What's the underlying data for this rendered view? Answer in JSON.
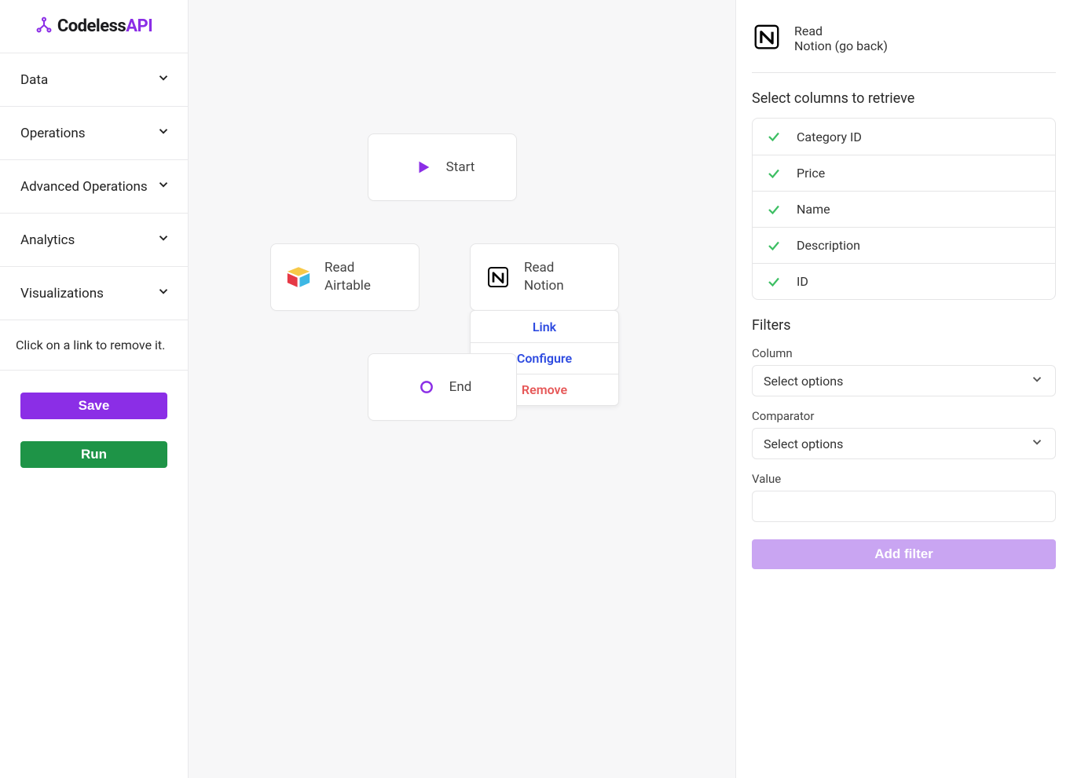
{
  "brand": {
    "pre": "Codeless",
    "post": "API"
  },
  "sidebar": {
    "items": [
      {
        "label": "Data"
      },
      {
        "label": "Operations"
      },
      {
        "label": "Advanced Operations"
      },
      {
        "label": "Analytics"
      },
      {
        "label": "Visualizations"
      }
    ],
    "hint": "Click on a link to remove it.",
    "save_label": "Save",
    "run_label": "Run"
  },
  "canvas": {
    "start_label": "Start",
    "end_label": "End",
    "airtable": {
      "line1": "Read",
      "line2": "Airtable"
    },
    "notion": {
      "line1": "Read",
      "line2": "Notion"
    },
    "ctx": {
      "link": "Link",
      "configure": "Configure",
      "remove": "Remove"
    }
  },
  "panel": {
    "header": {
      "line1": "Read",
      "line2": "Notion (go back)"
    },
    "columns_title": "Select columns to retrieve",
    "columns": [
      {
        "name": "Category ID",
        "checked": true
      },
      {
        "name": "Price",
        "checked": true
      },
      {
        "name": "Name",
        "checked": true
      },
      {
        "name": "Description",
        "checked": true
      },
      {
        "name": "ID",
        "checked": true
      }
    ],
    "filters_title": "Filters",
    "column_label": "Column",
    "column_placeholder": "Select options",
    "comparator_label": "Comparator",
    "comparator_placeholder": "Select options",
    "value_label": "Value",
    "value_value": "",
    "add_filter_label": "Add filter"
  }
}
